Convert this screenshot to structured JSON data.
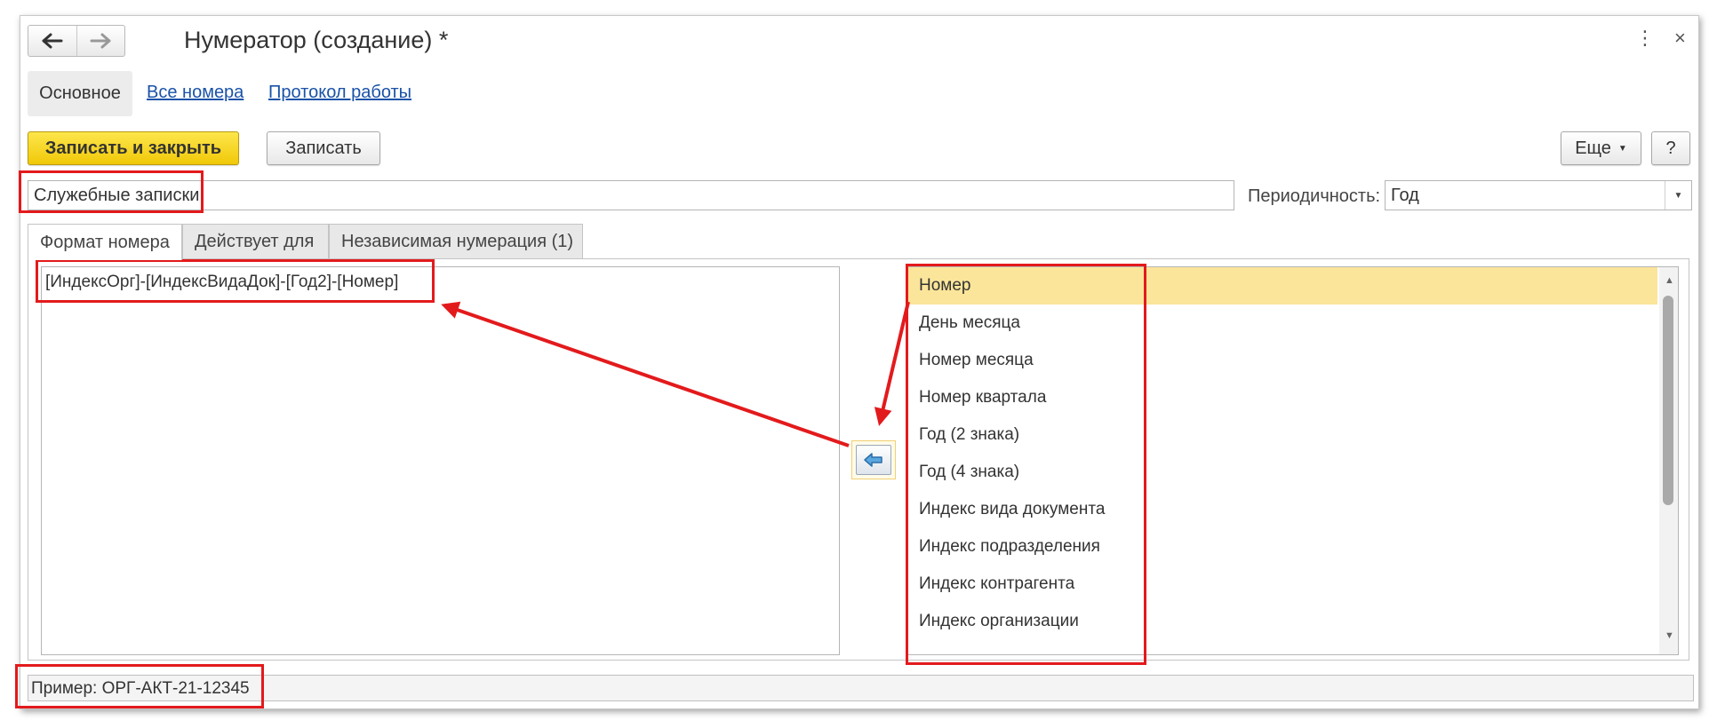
{
  "window": {
    "title": "Нумератор (создание) *",
    "more_icon": "more-vertical-icon",
    "close_icon": "close-icon",
    "close_glyph": "×",
    "more_glyph": "⋮"
  },
  "navigation": {
    "back_icon": "arrow-left-icon",
    "forward_icon": "arrow-right-icon"
  },
  "panel_tabs": [
    {
      "label": "Основное",
      "active": true
    },
    {
      "label": "Все номера",
      "active": false
    },
    {
      "label": "Протокол работы",
      "active": false
    }
  ],
  "commands": {
    "save_close": "Записать и закрыть",
    "save": "Записать",
    "more": "Еще",
    "help": "?"
  },
  "form": {
    "name_value": "Служебные записки",
    "periodicity_label": "Периодичность:",
    "periodicity_value": "Год"
  },
  "inner_tabs": [
    {
      "label": "Формат номера",
      "active": true
    },
    {
      "label": "Действует для",
      "active": false
    },
    {
      "label": "Независимая нумерация (1)",
      "active": false
    }
  ],
  "format": {
    "value": "[ИндексОрг]-[ИндексВидаДок]-[Год2]-[Номер]",
    "add_icon": "insert-left-arrow-icon"
  },
  "fields_list": [
    "Номер",
    "День месяца",
    "Номер месяца",
    "Номер квартала",
    "Год (2 знака)",
    "Год (4 знака)",
    "Индекс вида документа",
    "Индекс подразделения",
    "Индекс контрагента",
    "Индекс организации"
  ],
  "selected_field_index": 0,
  "example": "Пример: ОРГ-АКТ-21-12345",
  "colors": {
    "accent_yellow": "#f5d20e",
    "selected_row": "#fbe59a",
    "link": "#1a52a8",
    "annotation_red": "#e31a1c"
  }
}
